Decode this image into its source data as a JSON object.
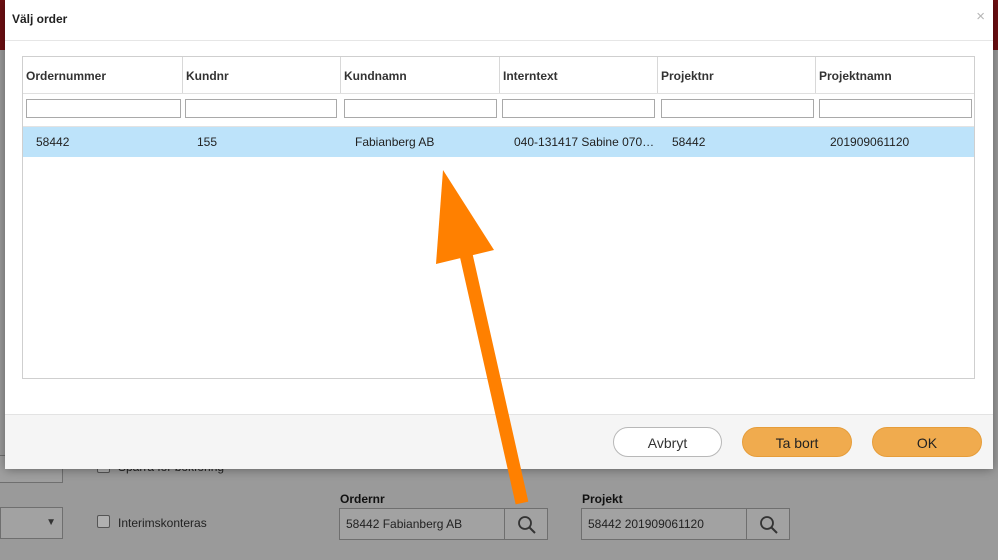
{
  "background": {
    "checkbox_top_label": "Spärra för bokföring",
    "checkbox_interim_label": "Interimskonteras",
    "ordernr_label": "Ordernr",
    "ordernr_value": "58442 Fabianberg AB",
    "projekt_label": "Projekt",
    "projekt_value": "58442 201909061120"
  },
  "modal": {
    "title": "Välj order",
    "close_glyph": "×",
    "columns": [
      "Ordernummer",
      "Kundnr",
      "Kundnamn",
      "Interntext",
      "Projektnr",
      "Projektnamn"
    ],
    "rows": [
      [
        "58442",
        "155",
        "Fabianberg AB",
        "040-131417 Sabine 070…",
        "58442",
        "201909061120"
      ]
    ],
    "buttons": {
      "cancel": "Avbryt",
      "remove": "Ta bort",
      "ok": "OK"
    }
  },
  "colors": {
    "selected_row": "#bde3fa",
    "primary_button": "#f0ab4e",
    "annotation_arrow": "#ff8000",
    "header_bar": "#6e0f12"
  }
}
